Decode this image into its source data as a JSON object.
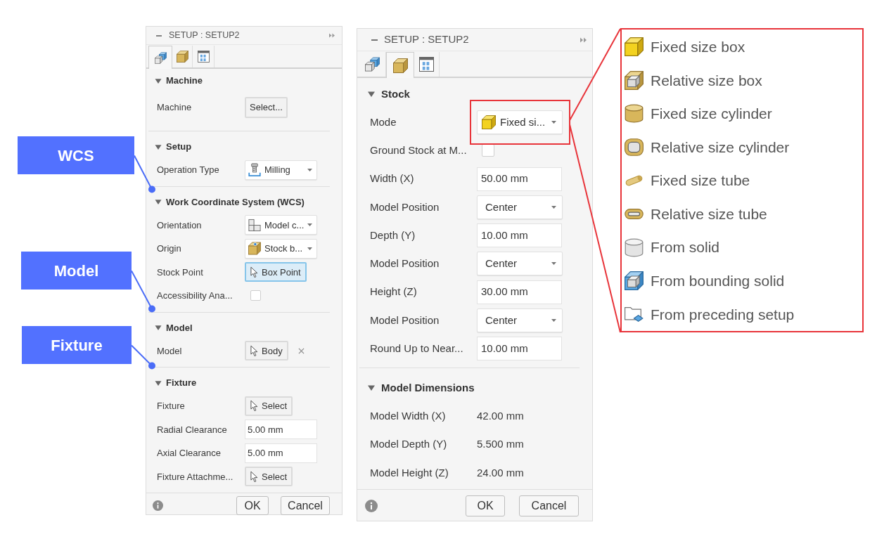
{
  "callouts": [
    {
      "label": "WCS"
    },
    {
      "label": "Model"
    },
    {
      "label": "Fixture"
    }
  ],
  "panels": [
    {
      "title": "SETUP : SETUP2",
      "tabs": [
        {
          "selected": true
        },
        {
          "selected": false
        },
        {
          "selected": false
        }
      ],
      "sections": [
        {
          "title": "Machine",
          "expanded": true,
          "rows": [
            {
              "kind": "button",
              "label": "Machine",
              "value": "Select..."
            }
          ]
        },
        {
          "title": "Setup",
          "expanded": true,
          "rows": [
            {
              "kind": "dropdown",
              "label": "Operation Type",
              "value": "Milling",
              "highlighted": false
            }
          ]
        },
        {
          "title": "Work Coordinate System (WCS)",
          "expanded": true,
          "rows": [
            {
              "kind": "dropdown",
              "label": "Orientation",
              "value": "Model c...",
              "highlighted": false
            },
            {
              "kind": "dropdown",
              "label": "Origin",
              "value": "Stock b...",
              "highlighted": false
            },
            {
              "kind": "picker",
              "label": "Stock Point",
              "value": "Box Point",
              "active": true,
              "clearable": false
            },
            {
              "kind": "checkbox",
              "label": "Accessibility Ana...",
              "checked": false
            }
          ]
        },
        {
          "title": "Model",
          "expanded": true,
          "rows": [
            {
              "kind": "picker",
              "label": "Model",
              "value": "Body",
              "active": false,
              "clearable": true
            }
          ]
        },
        {
          "title": "Fixture",
          "expanded": true,
          "rows": [
            {
              "kind": "picker",
              "label": "Fixture",
              "value": "Select",
              "active": false,
              "clearable": false
            },
            {
              "kind": "field",
              "label": "Radial Clearance",
              "value": "5.00 mm"
            },
            {
              "kind": "field",
              "label": "Axial Clearance",
              "value": "5.00 mm"
            },
            {
              "kind": "picker",
              "label": "Fixture Attachme...",
              "value": "Select",
              "active": false,
              "clearable": false
            }
          ]
        }
      ],
      "buttons": [
        "OK",
        "Cancel"
      ]
    },
    {
      "title": "SETUP : SETUP2",
      "tabs": [
        {
          "selected": false
        },
        {
          "selected": true
        },
        {
          "selected": false
        }
      ],
      "sections": [
        {
          "title": "Stock",
          "expanded": true,
          "rows": [
            {
              "kind": "dropdown",
              "label": "Mode",
              "value": "Fixed si...",
              "highlighted": true
            },
            {
              "kind": "checkbox",
              "label": "Ground Stock at M...",
              "checked": false
            },
            {
              "kind": "field",
              "label": "Width (X)",
              "value": "50.00 mm"
            },
            {
              "kind": "dropdown",
              "label": "Model Position",
              "value": "Center",
              "highlighted": false
            },
            {
              "kind": "field",
              "label": "Depth (Y)",
              "value": "10.00 mm"
            },
            {
              "kind": "dropdown",
              "label": "Model Position",
              "value": "Center",
              "highlighted": false
            },
            {
              "kind": "field",
              "label": "Height (Z)",
              "value": "30.00 mm"
            },
            {
              "kind": "dropdown",
              "label": "Model Position",
              "value": "Center",
              "highlighted": false
            },
            {
              "kind": "field",
              "label": "Round Up to Near...",
              "value": "10.00 mm"
            }
          ]
        },
        {
          "title": "Model Dimensions",
          "expanded": true,
          "rows": [
            {
              "kind": "readout",
              "label": "Model Width (X)",
              "value": "42.00 mm"
            },
            {
              "kind": "readout",
              "label": "Model Depth (Y)",
              "value": "5.500 mm"
            },
            {
              "kind": "readout",
              "label": "Model Height (Z)",
              "value": "24.00 mm"
            }
          ]
        }
      ],
      "buttons": [
        "OK",
        "Cancel"
      ]
    }
  ],
  "mode_options": [
    "Fixed size box",
    "Relative size box",
    "Fixed size cylinder",
    "Relative size cylinder",
    "Fixed size tube",
    "Relative size tube",
    "From solid",
    "From bounding solid",
    "From preceding setup"
  ]
}
